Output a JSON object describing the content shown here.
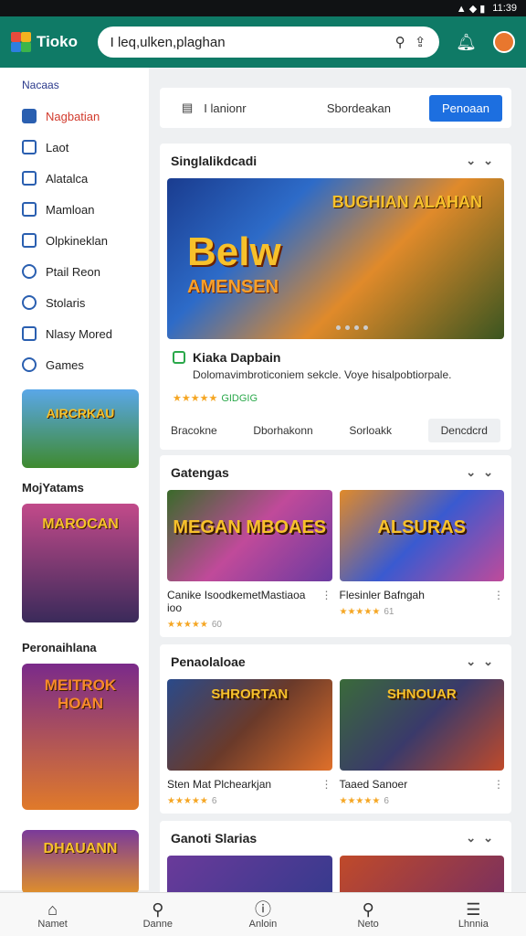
{
  "status": {
    "time": "11:39"
  },
  "app": {
    "name": "Tioko",
    "search_value": "I leq,ulken,plaghan"
  },
  "sidebar": {
    "title": "Nacaas",
    "items": [
      {
        "label": "Nagbatian",
        "active": true
      },
      {
        "label": "Laot"
      },
      {
        "label": "Alatalca"
      },
      {
        "label": "Mamloan"
      },
      {
        "label": "Olpkineklan"
      },
      {
        "label": "Ptail Reon"
      },
      {
        "label": "Stolaris"
      },
      {
        "label": "Nlasy Mored"
      },
      {
        "label": "Games"
      }
    ],
    "thumb1_title": "AIRCRKAU",
    "section2": "MojYatams",
    "thumb2_title": "MAROCAN",
    "section3": "Peronaihlana",
    "thumb3_title": "MEITROK HOAN",
    "thumb4_title": "DHAUANN"
  },
  "tabs": {
    "tab1": "I lanionr",
    "tab2": "Sbordeakan",
    "tab3": "Penoaan"
  },
  "featured": {
    "section_title": "Singlalikdcadi",
    "hero_title": "Belw",
    "hero_sub": "AMENSEN",
    "hero_badge": "BUGHIAN ALAHAN",
    "app_title": "Kiaka Dapbain",
    "desc": "Dolomavimbroticoniem sekcle. Voye hisalpobtiorpale.",
    "rating_text": "GIDGIG",
    "actions": [
      "Bracokne",
      "Dborhakonn",
      "Sorloakk",
      "Dencdcrd"
    ]
  },
  "categories": {
    "title": "Gatengas",
    "items": [
      {
        "name": "Canike IsoodkemetMastiaoa ioo",
        "image_title": "MEGAN MBOAES",
        "rating": "60"
      },
      {
        "name": "Flesinler Bafngah",
        "image_title": "ALSURAS",
        "rating": "61"
      }
    ]
  },
  "personal": {
    "title": "Penaolaloae",
    "items": [
      {
        "name": "Sten Mat Plchearkjan",
        "image_title": "SHRORTAN",
        "rating": "6"
      },
      {
        "name": "Taaed Sanoer",
        "image_title": "SHNOUAR",
        "rating": "6"
      }
    ]
  },
  "section4": {
    "title": "Ganoti Slarias"
  },
  "bottomnav": [
    "Namet",
    "Danne",
    "Anloin",
    "Neto",
    "Lhnnia"
  ]
}
